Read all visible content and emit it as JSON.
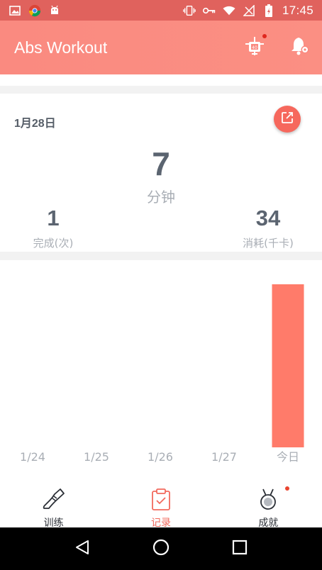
{
  "status_bar": {
    "time": "17:45",
    "background": "#e0625d",
    "left_icons": [
      "image-notification-icon",
      "chrome-app-icon",
      "android-robot-icon"
    ],
    "right_icons": [
      "vibrate-icon",
      "key-icon",
      "wifi-icon",
      "no-signal-icon",
      "battery-icon"
    ]
  },
  "app_header": {
    "title": "Abs Workout",
    "color": "#fa8a80",
    "actions": [
      "workout-plan-icon",
      "reminder-settings-icon"
    ]
  },
  "summary": {
    "date": "1月28日",
    "minutes_value": "7",
    "minutes_label": "分钟",
    "completed_value": "1",
    "completed_label": "完成(次)",
    "calories_value": "34",
    "calories_label": "消耗(千卡)"
  },
  "chart_data": {
    "type": "bar",
    "categories": [
      "1/24",
      "1/25",
      "1/26",
      "1/27",
      "今日"
    ],
    "values": [
      0,
      0,
      0,
      0,
      7
    ],
    "bar_color": "#ff7b6a",
    "ylim": [
      0,
      7
    ],
    "grid": false
  },
  "bottom_nav": {
    "items": [
      {
        "label": "训练",
        "icon": "sneaker-icon",
        "active": false
      },
      {
        "label": "记录",
        "icon": "clipboard-check-icon",
        "active": true
      },
      {
        "label": "成就",
        "icon": "medal-icon",
        "active": false
      }
    ],
    "active_color": "#f2695d"
  },
  "system_nav": [
    "back-icon",
    "home-icon",
    "recents-icon"
  ]
}
